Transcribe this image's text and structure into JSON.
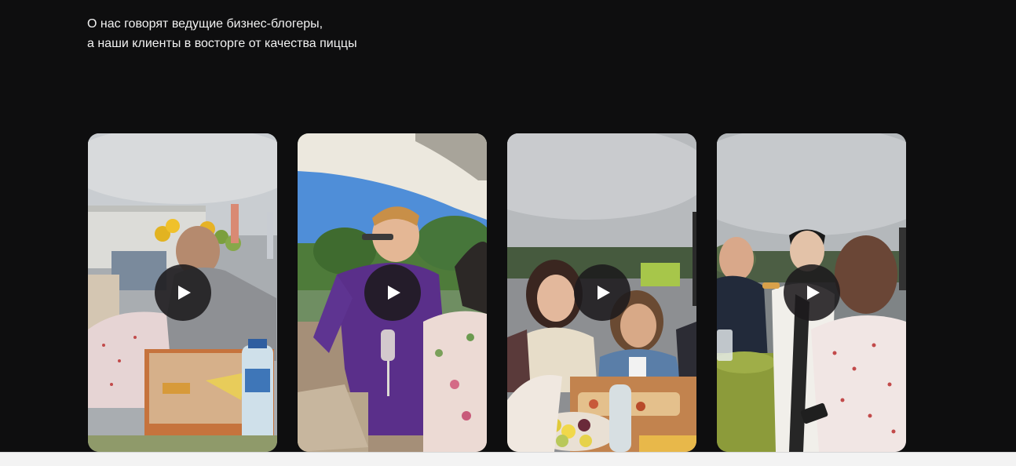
{
  "section": {
    "intro_lines": [
      "О нас говорят ведущие бизнес-блогеры,",
      "а наши клиенты в восторге от качества пиццы"
    ]
  },
  "videos": [
    {
      "play_icon": "play-icon",
      "scene": "outdoor party, man eating pizza from box, water bottle"
    },
    {
      "play_icon": "play-icon",
      "scene": "man in purple shirt with wine glass, woman in floral dress"
    },
    {
      "play_icon": "play-icon",
      "scene": "group of women eating pizza under cloudy sky"
    },
    {
      "play_icon": "play-icon",
      "scene": "people in cap and floral dress eating pizza"
    }
  ],
  "colors": {
    "background": "#0e0e0f",
    "text": "#f2f2f2",
    "play_button": "#1c1a1c",
    "bottom_strip": "#f3f3f3"
  }
}
